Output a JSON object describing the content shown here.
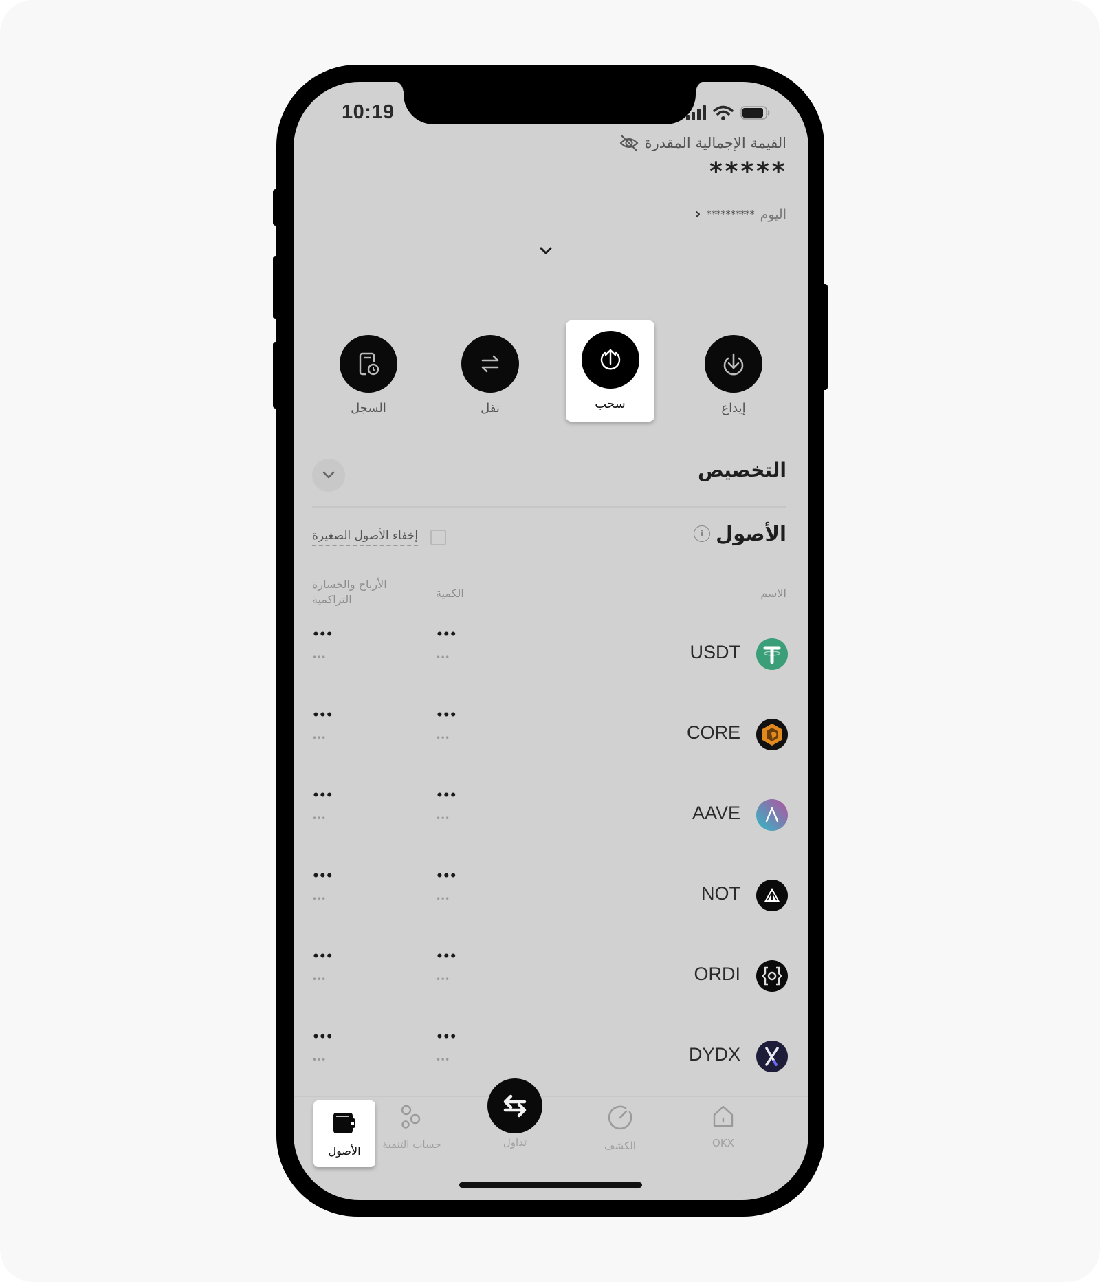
{
  "status_bar": {
    "time": "10:19",
    "icons": [
      "signal-icon",
      "wifi-icon",
      "battery-icon"
    ]
  },
  "header": {
    "total_label": "القيمة الإجمالية المقدرة",
    "total_value": "*****",
    "today_label": "اليوم",
    "today_value": "**********",
    "visibility_icon": "eye-off-icon"
  },
  "actions": [
    {
      "id": "deposit",
      "label": "إيداع",
      "icon": "deposit-icon"
    },
    {
      "id": "withdraw",
      "label": "سحب",
      "icon": "withdraw-icon",
      "highlighted": true
    },
    {
      "id": "transfer",
      "label": "نقل",
      "icon": "transfer-icon"
    },
    {
      "id": "history",
      "label": "السجل",
      "icon": "history-icon"
    }
  ],
  "customization": {
    "title": "التخصيص"
  },
  "assets": {
    "title": "الأصول",
    "hide_small_label": "إخفاء الأصول الصغيرة",
    "hide_small_checked": false,
    "columns": {
      "name": "الاسم",
      "quantity": "الكمية",
      "pnl": "الأرباح والخسارة التراكمية"
    },
    "rows": [
      {
        "symbol": "USDT",
        "color": "#3a9e78",
        "qty": "•••",
        "qty_sub": "•••",
        "pnl": "•••",
        "pnl_sub": "•••"
      },
      {
        "symbol": "CORE",
        "color": "#e08a1e",
        "qty": "•••",
        "qty_sub": "•••",
        "pnl": "•••",
        "pnl_sub": "•••"
      },
      {
        "symbol": "AAVE",
        "color": "#7a5ab8",
        "qty": "•••",
        "qty_sub": "•••",
        "pnl": "•••",
        "pnl_sub": "•••"
      },
      {
        "symbol": "NOT",
        "color": "#0a0a0a",
        "qty": "•••",
        "qty_sub": "•••",
        "pnl": "•••",
        "pnl_sub": "•••"
      },
      {
        "symbol": "ORDI",
        "color": "#0a0a0a",
        "qty": "•••",
        "qty_sub": "•••",
        "pnl": "•••",
        "pnl_sub": "•••"
      },
      {
        "symbol": "DYDX",
        "color": "#1d1d3a",
        "qty": "•••",
        "qty_sub": "•••",
        "pnl": "•••",
        "pnl_sub": "•••"
      }
    ]
  },
  "bottom_nav": {
    "items": [
      {
        "id": "okx",
        "label": "OKX",
        "icon": "home-icon"
      },
      {
        "id": "discover",
        "label": "الكشف",
        "icon": "discover-icon"
      },
      {
        "id": "trade",
        "label": "تداول",
        "icon": "trade-swap-icon"
      },
      {
        "id": "grow",
        "label": "حساب التنمية",
        "icon": "grow-icon"
      },
      {
        "id": "assets",
        "label": "الأصول",
        "icon": "wallet-icon",
        "active": true
      }
    ]
  }
}
